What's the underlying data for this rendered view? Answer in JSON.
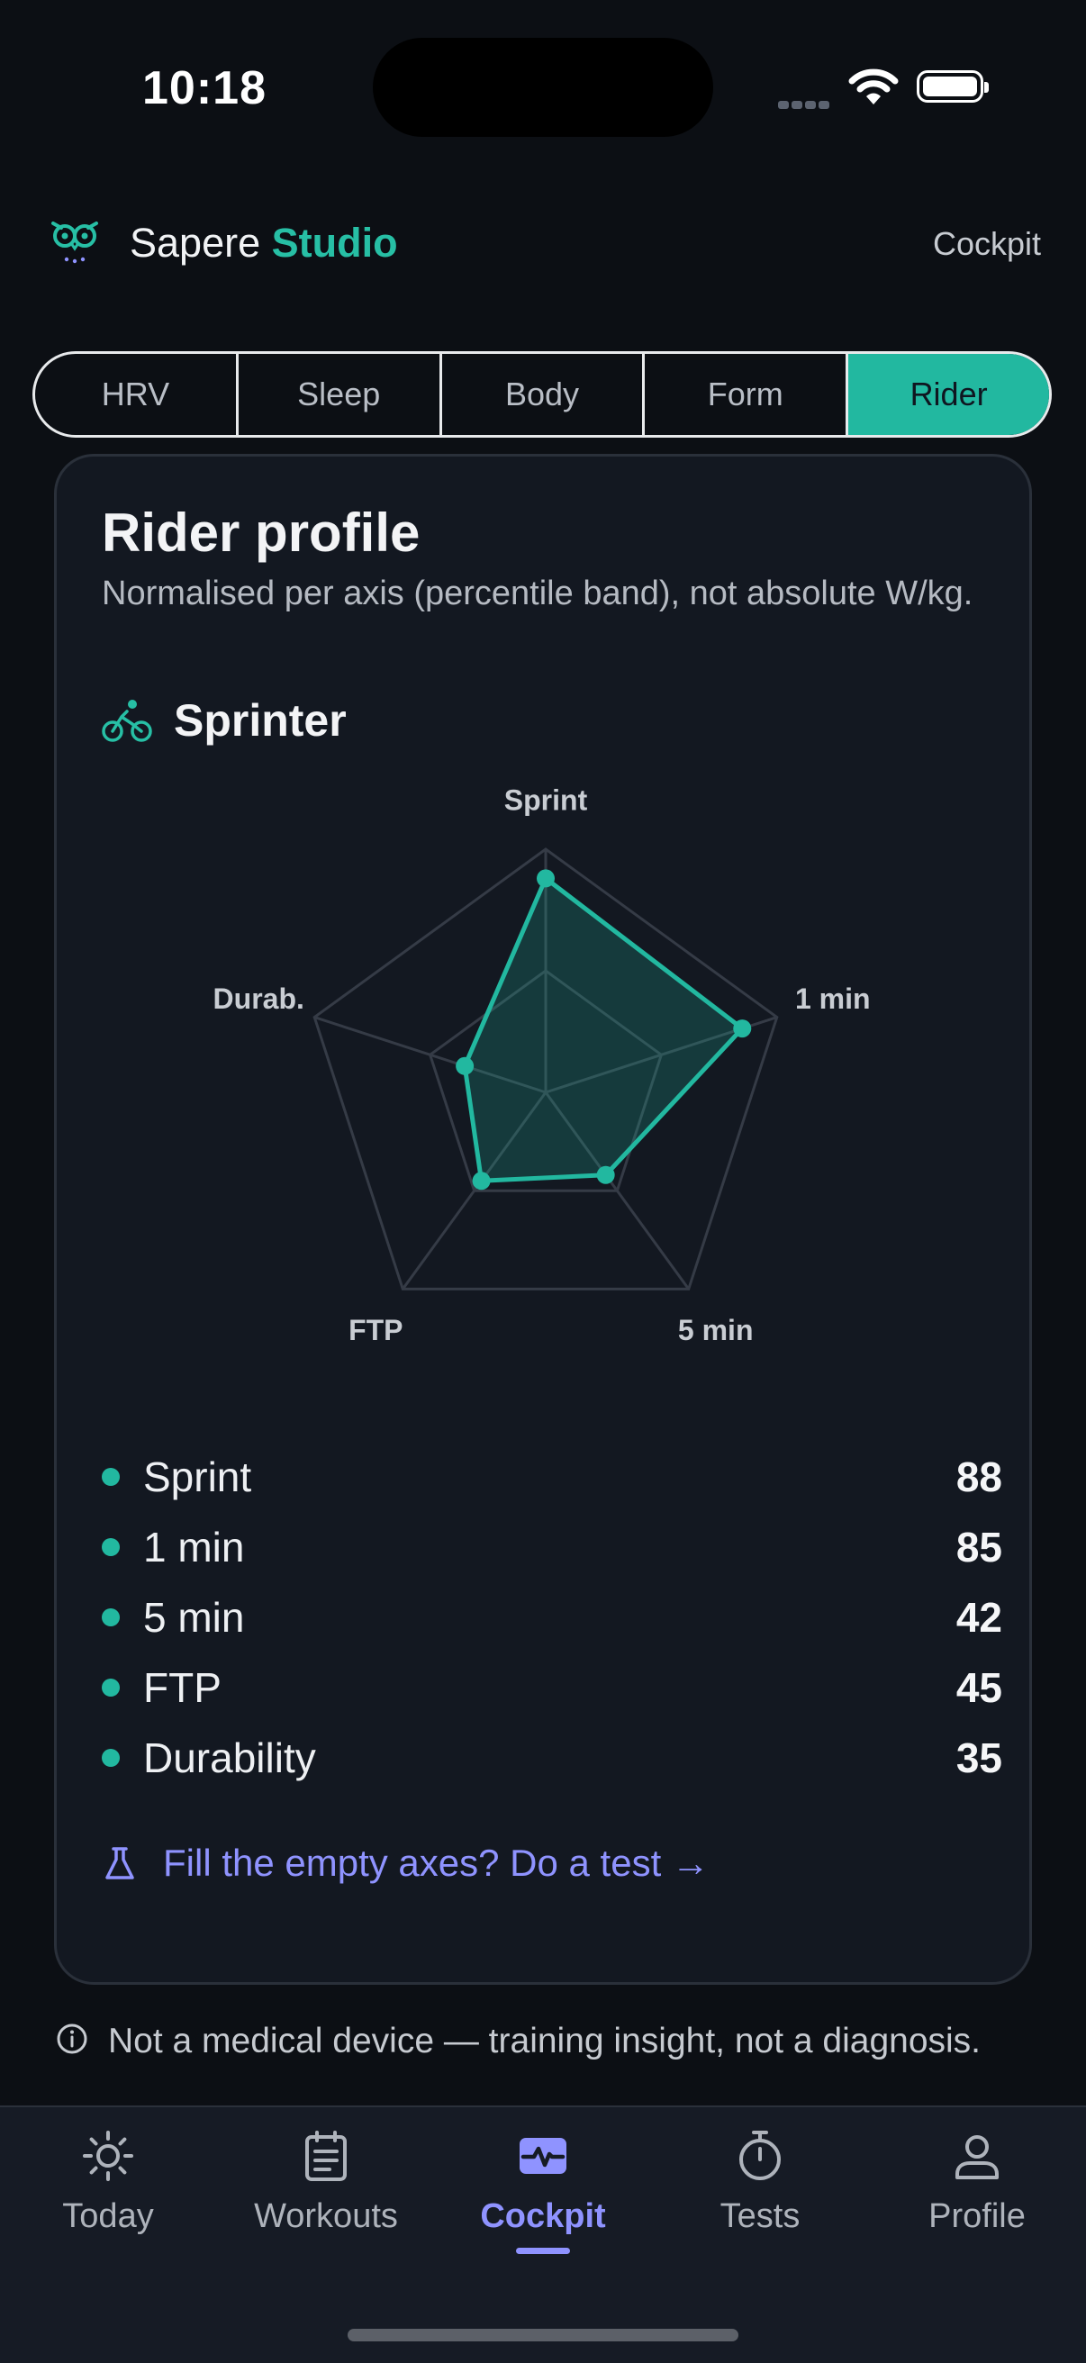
{
  "status_bar": {
    "time": "10:18"
  },
  "header": {
    "brand_name": "Sapere",
    "brand_accent": "Studio",
    "right_link": "Cockpit"
  },
  "tabs": [
    {
      "label": "HRV",
      "active": false
    },
    {
      "label": "Sleep",
      "active": false
    },
    {
      "label": "Body",
      "active": false
    },
    {
      "label": "Form",
      "active": false
    },
    {
      "label": "Rider",
      "active": true
    }
  ],
  "card": {
    "title": "Rider profile",
    "subtitle": "Normalised per axis (percentile band), not absolute W/kg.",
    "profile_icon": "bike-icon",
    "profile_name": "Sprinter",
    "test_link": "Fill the empty axes? Do a test →"
  },
  "chart_data": {
    "type": "radar",
    "axes": [
      "Sprint",
      "1 min",
      "5 min",
      "FTP",
      "Durab."
    ],
    "values": [
      88,
      85,
      42,
      45,
      35
    ],
    "range": [
      0,
      100
    ],
    "grid_levels": [
      50,
      100
    ]
  },
  "metrics": [
    {
      "name": "Sprint",
      "value": "88"
    },
    {
      "name": "1 min",
      "value": "85"
    },
    {
      "name": "5 min",
      "value": "42"
    },
    {
      "name": "FTP",
      "value": "45"
    },
    {
      "name": "Durability",
      "value": "35"
    }
  ],
  "disclaimer": "Not a medical device — training insight, not a diagnosis.",
  "bottom_nav": [
    {
      "label": "Today",
      "icon": "sun-icon",
      "active": false
    },
    {
      "label": "Workouts",
      "icon": "clipboard-icon",
      "active": false
    },
    {
      "label": "Cockpit",
      "icon": "activity-icon",
      "active": true
    },
    {
      "label": "Tests",
      "icon": "stopwatch-icon",
      "active": false
    },
    {
      "label": "Profile",
      "icon": "person-icon",
      "active": false
    }
  ],
  "colors": {
    "accent": "#22b8a0",
    "link": "#8f93ff",
    "background": "#0c0f14",
    "card": "#131821"
  }
}
